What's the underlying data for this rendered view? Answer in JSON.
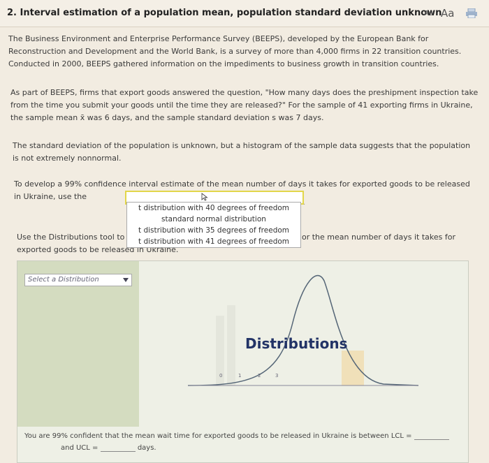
{
  "header": {
    "title": "2. Interval estimation of a population mean, population standard deviation unknown",
    "font_small": "Aa",
    "font_large": "Aa",
    "icon": "printer-icon"
  },
  "paragraphs": {
    "intro": "The Business Environment and Enterprise Performance Survey (BEEPS), developed by the European Bank for Reconstruction and Development and the World Bank, is a survey of more than 4,000 firms in 22 transition countries. Conducted in 2000, BEEPS gathered information on the impediments to business growth in transition countries.",
    "question": "As part of BEEPS, firms that export goods answered the question, \"How many days does the preshipment inspection take from the time you submit your goods until the time they are released?\" For the sample of 41 exporting firms in Ukraine, the sample mean x̄ was 6 days, and the sample standard deviation s was 7 days.",
    "assumption": "The standard deviation of the population is unknown, but a histogram of the sample data suggests that the population is not extremely nonnormal.",
    "prompt_prefix": "To develop a 99% confidence interval estimate of the mean number of days it takes for exported goods to be released in Ukraine, use the",
    "tool_left": "Use the Distributions tool to",
    "tool_right": "or the mean number of days it takes for",
    "tool_bottom": "exported goods to be released in Ukraine."
  },
  "dropdown": {
    "selected": "",
    "options": [
      "t distribution with 40 degrees of freedom",
      "standard normal distribution",
      "t distribution with 35 degrees of freedom",
      "t distribution with 41 degrees of freedom"
    ]
  },
  "tool": {
    "select_label": "Select a Distribution",
    "overlay_label": "Distributions",
    "axis_ticks": [
      "0",
      "1",
      "2",
      "3"
    ]
  },
  "answer": {
    "line1": "You are 99% confident that the mean wait time for exported goods to be released in Ukraine is between LCL =",
    "ucl_label": "and UCL =",
    "unit": "days."
  },
  "colors": {
    "background": "#f2ece1",
    "highlight_border": "#e2d64a",
    "panel_left": "#d4dcc0",
    "tail_fill": "#f0dcae",
    "overlay_text": "#223366"
  }
}
